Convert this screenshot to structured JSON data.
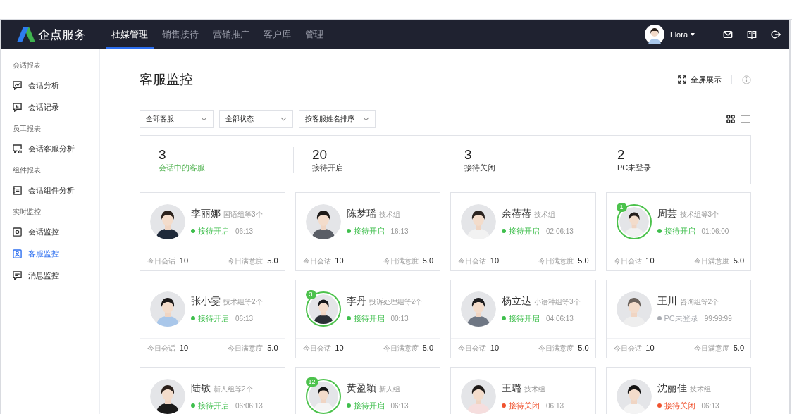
{
  "header": {
    "brand": "企点服务",
    "tabs": [
      {
        "label": "社媒管理",
        "selected": true
      },
      {
        "label": "销售接待",
        "selected": false
      },
      {
        "label": "营销推广",
        "selected": false
      },
      {
        "label": "客户库",
        "selected": false
      },
      {
        "label": "管理",
        "selected": false
      }
    ],
    "user": {
      "name": "Flora"
    }
  },
  "sidebar": {
    "groups": [
      {
        "title": "会话报表",
        "items": [
          {
            "label": "会话分析",
            "selected": false
          },
          {
            "label": "会话记录",
            "selected": false
          }
        ]
      },
      {
        "title": "员工报表",
        "items": [
          {
            "label": "会话客服分析",
            "selected": false
          }
        ]
      },
      {
        "title": "组件报表",
        "items": [
          {
            "label": "会话组件分析",
            "selected": false
          }
        ]
      },
      {
        "title": "实时监控",
        "items": [
          {
            "label": "会话监控",
            "selected": false
          },
          {
            "label": "客服监控",
            "selected": true
          },
          {
            "label": "消息监控",
            "selected": false
          }
        ]
      }
    ]
  },
  "page": {
    "title": "客服监控",
    "fullscreen_label": "全屏展示",
    "filters": [
      {
        "value": "全部客服"
      },
      {
        "value": "全部状态"
      },
      {
        "value": "按客服姓名排序"
      }
    ],
    "views": [
      {
        "kind": "grid",
        "selected": true
      },
      {
        "kind": "list",
        "selected": false
      }
    ],
    "stats": [
      {
        "value": "3",
        "label": "会话中的客服",
        "highlighted": true
      },
      {
        "value": "20",
        "label": "接待开启",
        "highlighted": false
      },
      {
        "value": "3",
        "label": "接待关闭",
        "highlighted": false
      },
      {
        "value": "2",
        "label": "PC未登录",
        "highlighted": false
      }
    ],
    "agents": [
      {
        "name": "李丽娜",
        "group": "国语组等3个",
        "status": "接待开启",
        "color": "#3fbf4d",
        "time": "06:13",
        "chats_label": "今日会话",
        "chats": "10",
        "score_label": "今日满意度",
        "score": "5.0"
      },
      {
        "name": "陈梦瑶",
        "group": "技术组",
        "status": "接待开启",
        "color": "#3fbf4d",
        "time": "16:13",
        "chats_label": "今日会话",
        "chats": "10",
        "score_label": "今日满意度",
        "score": "5.0"
      },
      {
        "name": "余蓓蓓",
        "group": "技术组",
        "status": "接待开启",
        "color": "#3fbf4d",
        "time": "02:06:13",
        "chats_label": "今日会话",
        "chats": "10",
        "score_label": "今日满意度",
        "score": "5.0"
      },
      {
        "name": "周芸",
        "group": "技术组等3个",
        "status": "接待开启",
        "color": "#3fbf4d",
        "time": "01:06:00",
        "badge": "1",
        "chats_label": "今日会话",
        "chats": "10",
        "score_label": "今日满意度",
        "score": "5.0"
      },
      {
        "name": "张小雯",
        "group": "技术组等2个",
        "status": "接待开启",
        "color": "#3fbf4d",
        "time": "06:13",
        "chats_label": "今日会话",
        "chats": "10",
        "score_label": "今日满意度",
        "score": "5.0"
      },
      {
        "name": "李丹",
        "group": "投诉处理组等2个",
        "status": "接待开启",
        "color": "#3fbf4d",
        "time": "00:13",
        "badge": "3",
        "chats_label": "今日会话",
        "chats": "10",
        "score_label": "今日满意度",
        "score": "5.0"
      },
      {
        "name": "杨立达",
        "group": "小语种组等3个",
        "status": "接待开启",
        "color": "#3fbf4d",
        "time": "04:06:13",
        "chats_label": "今日会话",
        "chats": "10",
        "score_label": "今日满意度",
        "score": "5.0"
      },
      {
        "name": "王川",
        "group": "咨询组等2个",
        "status": "PC未登录",
        "color": "#a9acb2",
        "time": "99:99:99",
        "chats_label": "今日会话",
        "chats": "10",
        "score_label": "今日满意度",
        "score": "5.0"
      },
      {
        "name": "陆敏",
        "group": "新人组等2个",
        "status": "接待开启",
        "color": "#3fbf4d",
        "time": "06:06:13"
      },
      {
        "name": "黄盈颖",
        "group": "新人组",
        "status": "接待开启",
        "color": "#3fbf4d",
        "time": "06:13",
        "badge": "12"
      },
      {
        "name": "王璐",
        "group": "技术组",
        "status": "接待关闭",
        "color": "#f0532f",
        "time": "06:13"
      },
      {
        "name": "沈丽佳",
        "group": "技术组",
        "status": "接待关闭",
        "color": "#f0532f",
        "time": "06:13"
      }
    ]
  }
}
